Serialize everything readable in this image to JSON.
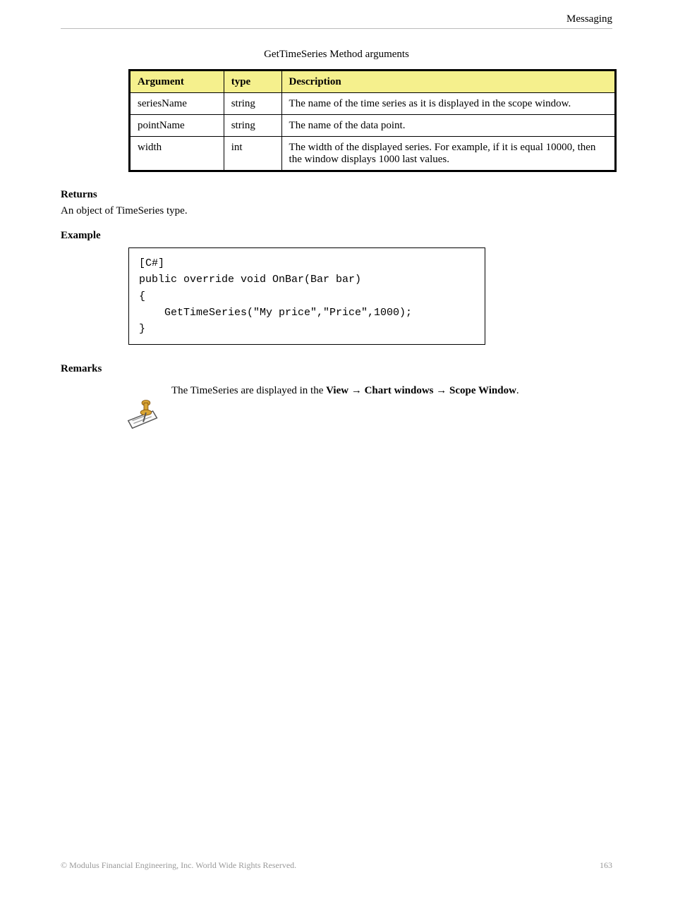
{
  "header": {
    "section": "Messaging"
  },
  "table_title": "GetTimeSeries Method arguments",
  "columns": {
    "arg": "Argument",
    "type": "type",
    "desc": "Description"
  },
  "rows": [
    {
      "arg": "seriesName",
      "type": "string",
      "desc": "The name of the time series as it is displayed in the scope window."
    },
    {
      "arg": "pointName",
      "type": "string",
      "desc": "The name of the data point."
    },
    {
      "arg": "width",
      "type": "int",
      "desc": "The width of the displayed series. For example, if it is equal 10000, then the window displays 1000 last values."
    }
  ],
  "returns": {
    "label": "Returns",
    "text": "An object of TimeSeries type."
  },
  "example": {
    "label": "Example",
    "code": "[C#]\npublic override void OnBar(Bar bar)\n{\n    GetTimeSeries(\"My price\",\"Price\",1000);\n}"
  },
  "remarks": {
    "label": "Remarks",
    "text_before": "The TimeSeries are displayed in the ",
    "menu_path_1": "View",
    "menu_path_2": "Chart windows",
    "menu_path_3": "Scope Window",
    "text_after": "."
  },
  "footer": {
    "left": "© Modulus Financial Engineering, Inc. World Wide Rights Reserved.",
    "right": "163"
  }
}
